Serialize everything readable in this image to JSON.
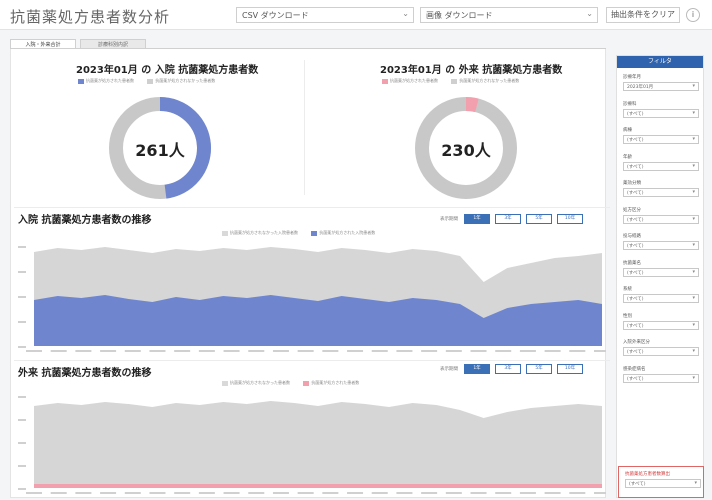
{
  "header": {
    "title": "抗菌薬処方患者数分析",
    "csv_download": "CSV ダウンロード",
    "image_download": "画像 ダウンロード",
    "clear_filters": "抽出条件をクリア",
    "info": "i"
  },
  "tabs": [
    "入院・外来合計",
    "診療科別内訳"
  ],
  "inpatient": {
    "title": "2023年01月 の 入院 抗菌薬処方患者数",
    "legend": [
      "抗菌薬が処方された患者数",
      "抗菌薬が処方されなかった患者数"
    ],
    "value_label": "261人",
    "prescribed": 261,
    "color": "#6f86cf"
  },
  "outpatient": {
    "title": "2023年01月 の 外来 抗菌薬処方患者数",
    "legend": [
      "抗菌薬が処方された患者数",
      "抗菌薬が処方されなかった患者数"
    ],
    "value_label": "230人",
    "prescribed": 230,
    "color": "#f2a0ae"
  },
  "trend_inpatient": {
    "title": "入院 抗菌薬処方患者数の推移",
    "legend": [
      "抗菌薬が処方されなかった入院患者数",
      "抗菌薬が処方された入院患者数"
    ],
    "period_label": "表示期間",
    "periods": [
      "1年",
      "3年",
      "5年",
      "10年"
    ]
  },
  "trend_outpatient": {
    "title": "外来 抗菌薬処方患者数の推移",
    "legend": [
      "抗菌薬が処方されなかった患者数",
      "抗菌薬が処方された患者数"
    ],
    "period_label": "表示期間",
    "periods": [
      "1年",
      "3年",
      "5年",
      "10年"
    ]
  },
  "sidebar": {
    "header": "フィルタ",
    "filters": [
      {
        "label": "診療年月",
        "value": "2023年01月"
      },
      {
        "label": "診療科",
        "value": "(すべて)"
      },
      {
        "label": "病棟",
        "value": "(すべて)"
      },
      {
        "label": "年齢",
        "value": "(すべて)"
      },
      {
        "label": "薬効分類",
        "value": "(すべて)"
      },
      {
        "label": "処方区分",
        "value": "(すべて)"
      },
      {
        "label": "投与経路",
        "value": "(すべて)"
      },
      {
        "label": "抗菌薬名",
        "value": "(すべて)"
      },
      {
        "label": "系統",
        "value": "(すべて)"
      },
      {
        "label": "性別",
        "value": "(すべて)"
      },
      {
        "label": "入院外来区分",
        "value": "(すべて)"
      },
      {
        "label": "感染症病名",
        "value": "(すべて)"
      }
    ],
    "warning": {
      "label": "抗菌薬処方患者数算出",
      "value": "(すべて)"
    }
  }
}
